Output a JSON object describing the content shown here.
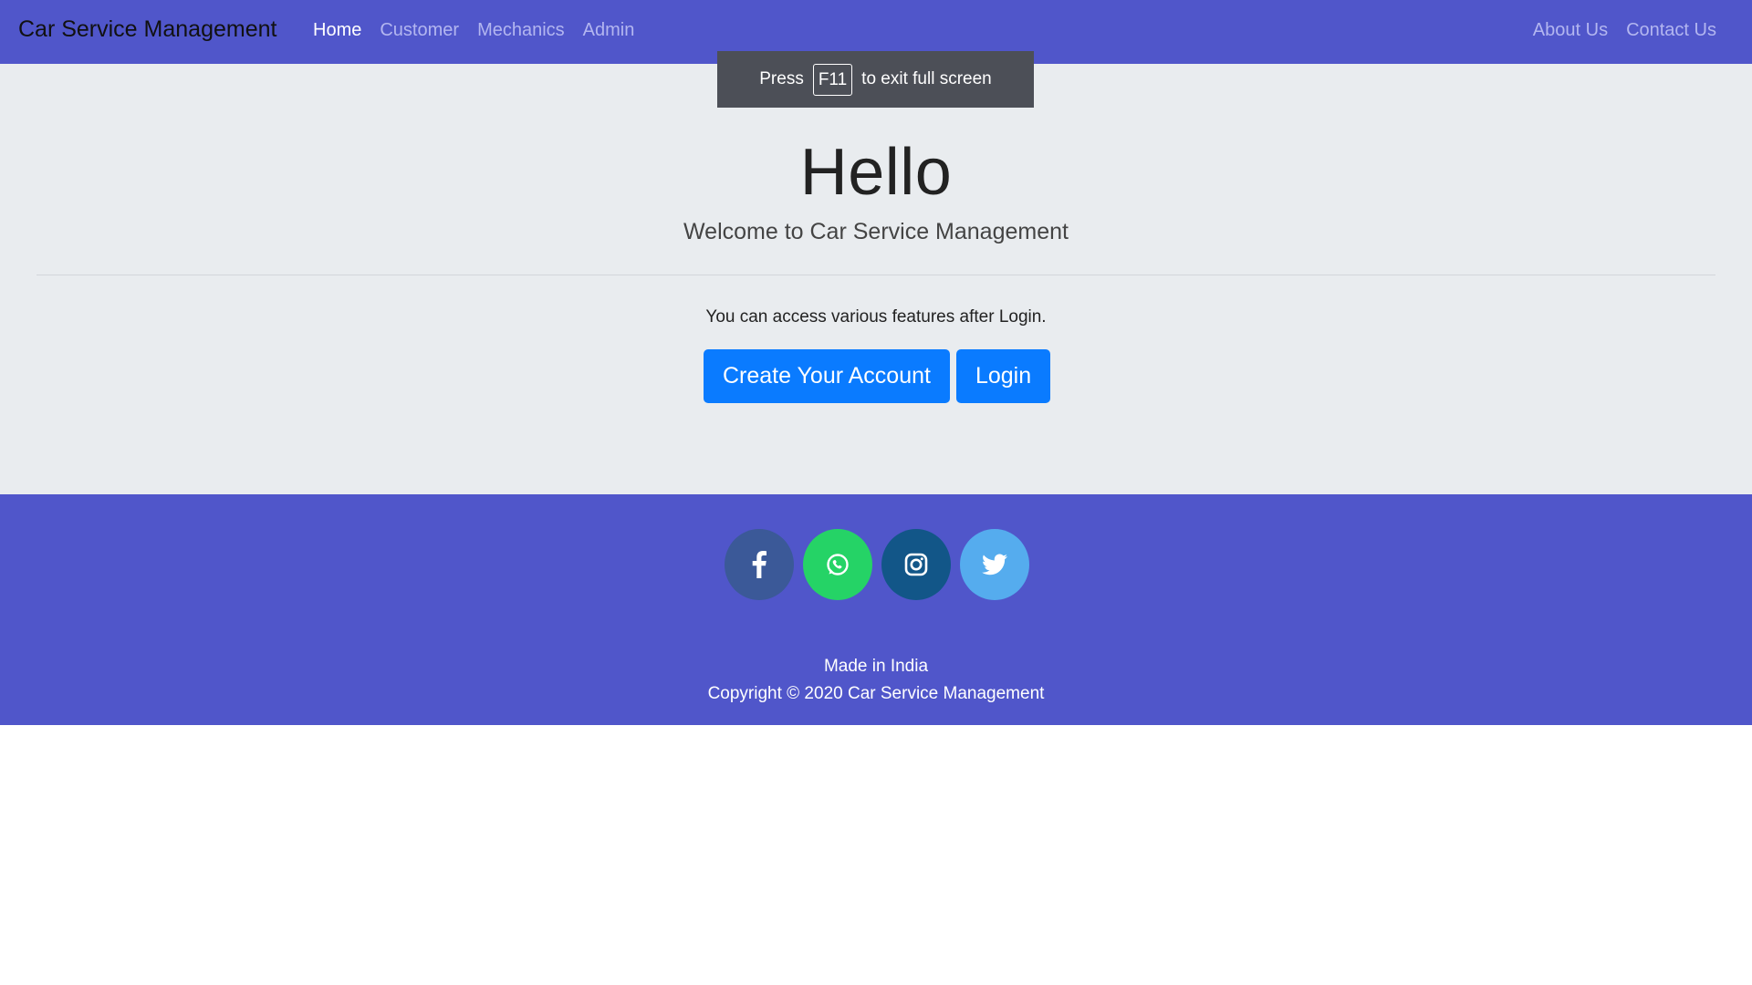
{
  "navbar": {
    "brand": "Car Service Management",
    "left_links": [
      "Home",
      "Customer",
      "Mechanics",
      "Admin"
    ],
    "right_links": [
      "About Us",
      "Contact Us"
    ],
    "active": "Home",
    "bg_color": "#5056ca"
  },
  "fullscreen_notice": {
    "prefix": "Press",
    "key": "F11",
    "suffix": "to exit full screen"
  },
  "hero": {
    "title": "Hello",
    "subtitle": "Welcome to Car Service Management",
    "info": "You can access various features after Login.",
    "create_button": "Create Your Account",
    "login_button": "Login",
    "button_color": "#0a7bff"
  },
  "footer": {
    "social_icons": [
      "facebook-icon",
      "whatsapp-icon",
      "instagram-icon",
      "twitter-icon"
    ],
    "made_in": "Made in India",
    "copyright": "Copyright © 2020 Car Service Management"
  }
}
